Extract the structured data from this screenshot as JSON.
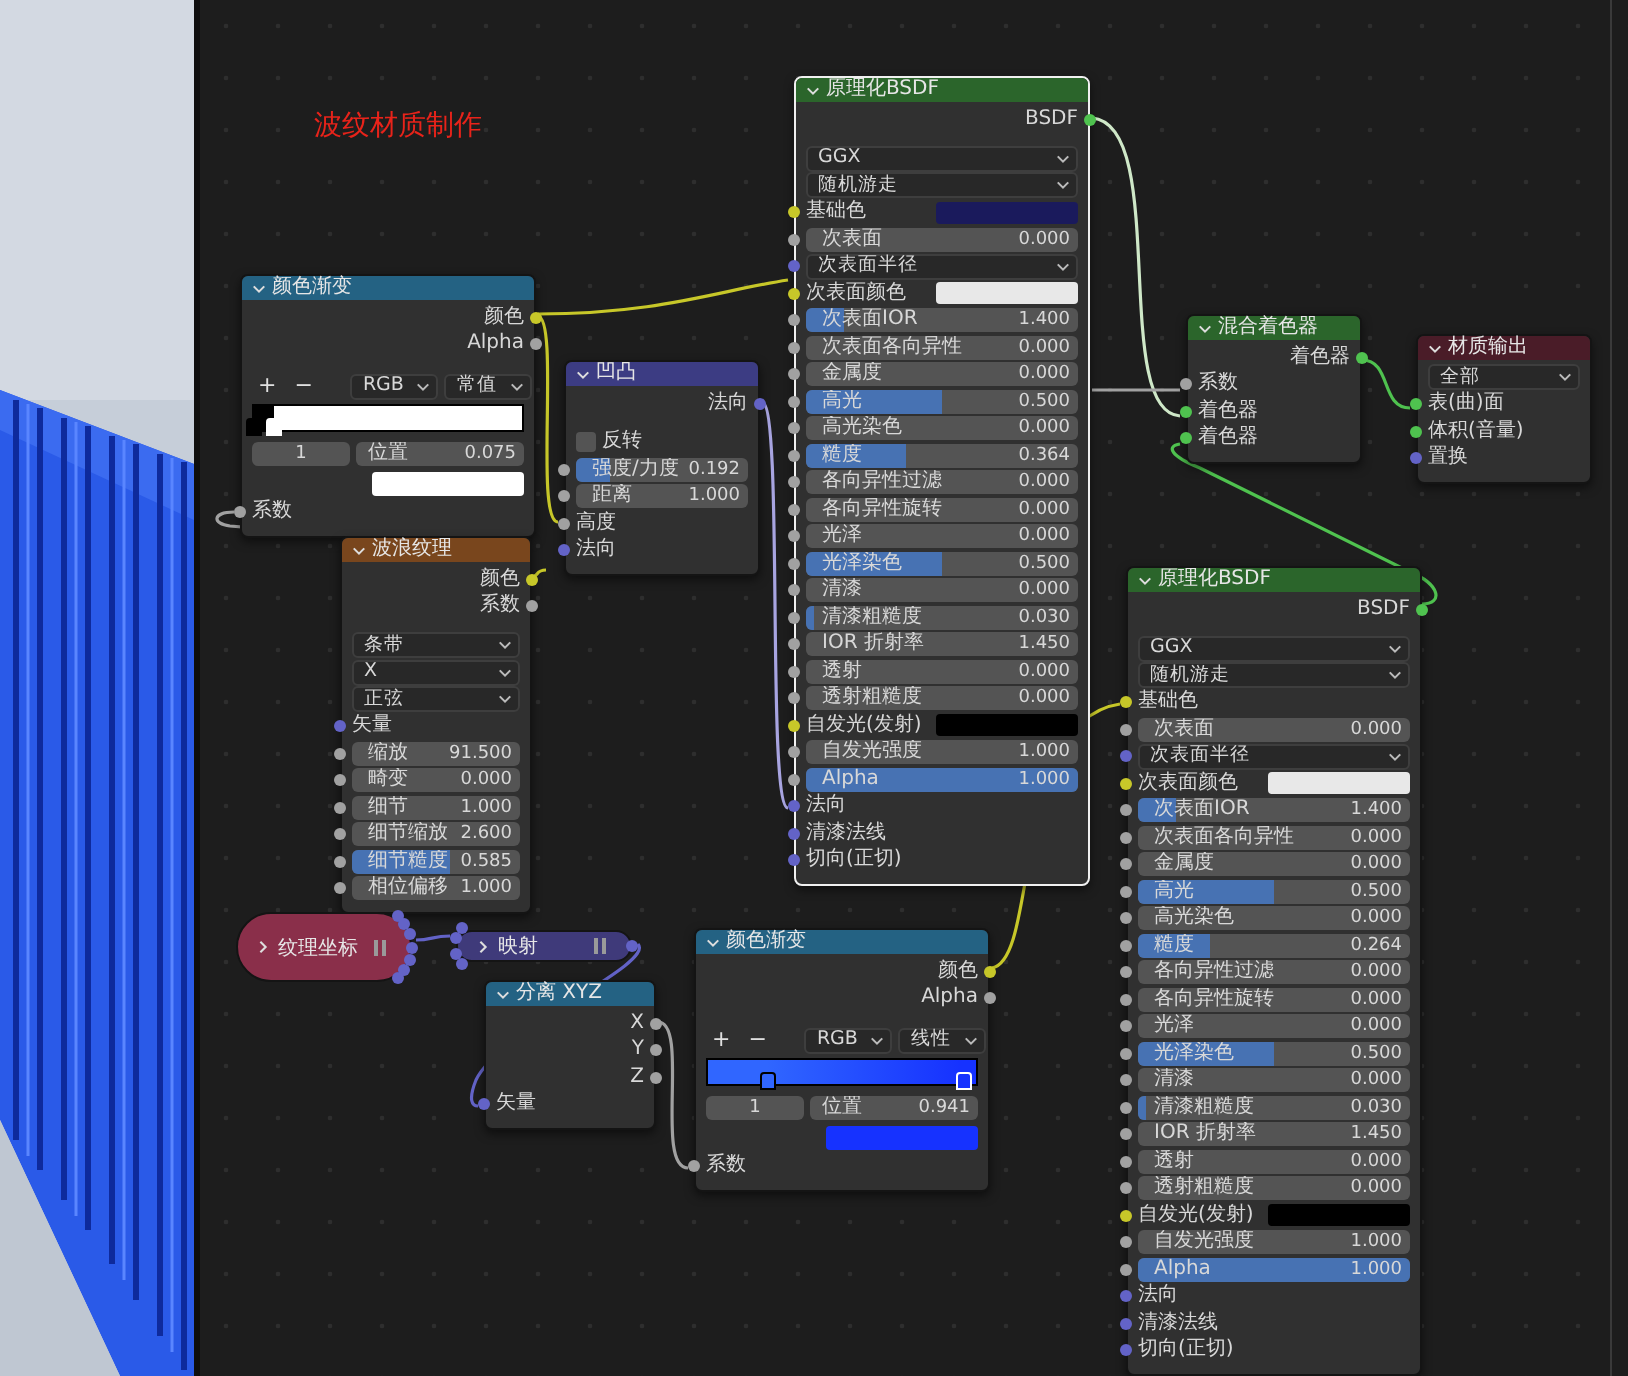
{
  "canvas_title": "波纹材质制作",
  "nodes": [
    {
      "kind": "node",
      "title": "原理化BSDF",
      "color": "#2b652b",
      "selected": true,
      "rows": [
        {
          "kind": "output",
          "label": "BSDF",
          "socket": {
            "color": "#4fc24f"
          }
        },
        {
          "kind": "dropdown",
          "label": "GGX"
        },
        {
          "kind": "dropdown",
          "label": "随机游走"
        },
        {
          "kind": "color",
          "label": "基础色",
          "color": "#1a1a5c",
          "socket": {
            "color": "#c7c729"
          }
        },
        {
          "kind": "number",
          "label": "次表面",
          "value": "0.000",
          "socket": {
            "color": "#a1a1a1"
          }
        },
        {
          "kind": "dropdown",
          "label": "次表面半径",
          "socket": {
            "color": "#6363c7"
          }
        },
        {
          "kind": "color",
          "label": "次表面颜色",
          "color": "#e8e8e8",
          "socket": {
            "color": "#c7c729"
          }
        },
        {
          "kind": "slider",
          "label": "次表面IOR",
          "value": "1.400",
          "level": 0.14,
          "socket": {
            "color": "#a1a1a1"
          }
        },
        {
          "kind": "number",
          "label": "次表面各向异性",
          "value": "0.000",
          "socket": {
            "color": "#a1a1a1"
          }
        },
        {
          "kind": "number",
          "label": "金属度",
          "value": "0.000",
          "socket": {
            "color": "#a1a1a1"
          }
        },
        {
          "kind": "slider",
          "label": "高光",
          "value": "0.500",
          "level": 0.5,
          "socket": {
            "color": "#a1a1a1"
          }
        },
        {
          "kind": "number",
          "label": "高光染色",
          "value": "0.000",
          "socket": {
            "color": "#a1a1a1"
          }
        },
        {
          "kind": "slider",
          "label": "糙度",
          "value": "0.364",
          "level": 0.364,
          "socket": {
            "color": "#a1a1a1"
          }
        },
        {
          "kind": "number",
          "label": "各向异性过滤",
          "value": "0.000",
          "socket": {
            "color": "#a1a1a1"
          }
        },
        {
          "kind": "number",
          "label": "各向异性旋转",
          "value": "0.000",
          "socket": {
            "color": "#a1a1a1"
          }
        },
        {
          "kind": "number",
          "label": "光泽",
          "value": "0.000",
          "socket": {
            "color": "#a1a1a1"
          }
        },
        {
          "kind": "slider",
          "label": "光泽染色",
          "value": "0.500",
          "level": 0.5,
          "socket": {
            "color": "#a1a1a1"
          }
        },
        {
          "kind": "number",
          "label": "清漆",
          "value": "0.000",
          "socket": {
            "color": "#a1a1a1"
          }
        },
        {
          "kind": "slider",
          "label": "清漆粗糙度",
          "value": "0.030",
          "level": 0.03,
          "socket": {
            "color": "#a1a1a1"
          }
        },
        {
          "kind": "number",
          "label": "IOR 折射率",
          "value": "1.450",
          "socket": {
            "color": "#a1a1a1"
          }
        },
        {
          "kind": "number",
          "label": "透射",
          "value": "0.000",
          "socket": {
            "color": "#a1a1a1"
          }
        },
        {
          "kind": "number",
          "label": "透射粗糙度",
          "value": "0.000",
          "socket": {
            "color": "#a1a1a1"
          }
        },
        {
          "kind": "color",
          "label": "自发光(发射)",
          "color": "#000000",
          "socket": {
            "color": "#c7c729"
          }
        },
        {
          "kind": "number",
          "label": "自发光强度",
          "value": "1.000",
          "socket": {
            "color": "#a1a1a1"
          }
        },
        {
          "kind": "slider",
          "label": "Alpha",
          "value": "1.000",
          "level": 1,
          "socket": {
            "color": "#a1a1a1"
          }
        },
        {
          "kind": "input",
          "label": "法向",
          "socket": {
            "color": "#6363c7"
          }
        },
        {
          "kind": "input",
          "label": "清漆法线",
          "socket": {
            "color": "#6363c7"
          }
        },
        {
          "kind": "input",
          "label": "切向(正切)",
          "socket": {
            "color": "#6363c7"
          }
        }
      ]
    },
    {
      "kind": "node",
      "title": "颜色渐变",
      "color": "#246283",
      "selected": false,
      "rows": [
        {
          "kind": "output",
          "label": "颜色",
          "socket": {
            "color": "#c7c729"
          }
        },
        {
          "kind": "output",
          "label": "Alpha",
          "socket": {
            "color": "#a1a1a1"
          }
        },
        {
          "kind": "ramp_controls",
          "add": "+",
          "remove": "−",
          "color_mode": "RGB",
          "interpolation": "常值"
        },
        {
          "kind": "ramp",
          "constant": true,
          "stops": [
            {
              "level": 0,
              "color": "#000000",
              "selected": false
            },
            {
              "level": 0.075,
              "color": "#ffffff",
              "selected": true
            }
          ]
        },
        {
          "kind": "ramp_position",
          "index": "1",
          "label": "位置",
          "value": "0.075"
        },
        {
          "kind": "swatch",
          "color": "#ffffff"
        },
        {
          "kind": "input",
          "label": "系数",
          "socket": {
            "color": "#a1a1a1"
          }
        }
      ]
    },
    {
      "kind": "node",
      "title": "凹凸",
      "color": "#3c3c83",
      "selected": false,
      "rows": [
        {
          "kind": "output",
          "label": "法向",
          "socket": {
            "color": "#6363c7"
          }
        },
        {
          "kind": "checkbox",
          "label": "反转",
          "checked": false
        },
        {
          "kind": "slider",
          "label": "强度/力度",
          "value": "0.192",
          "level": 0.192,
          "socket": {
            "color": "#a1a1a1"
          }
        },
        {
          "kind": "number",
          "label": "距离",
          "value": "1.000",
          "socket": {
            "color": "#a1a1a1"
          }
        },
        {
          "kind": "input",
          "label": "高度",
          "socket": {
            "color": "#a1a1a1"
          }
        },
        {
          "kind": "input",
          "label": "法向",
          "socket": {
            "color": "#6363c7"
          }
        }
      ]
    },
    {
      "kind": "node",
      "title": "混合着色器",
      "color": "#2b652b",
      "selected": false,
      "rows": [
        {
          "kind": "output",
          "label": "着色器",
          "socket": {
            "color": "#4fc24f"
          }
        },
        {
          "kind": "input",
          "label": "系数",
          "socket": {
            "color": "#a1a1a1"
          }
        },
        {
          "kind": "input",
          "label": "着色器",
          "socket": {
            "color": "#4fc24f"
          }
        },
        {
          "kind": "input",
          "label": "着色器",
          "socket": {
            "color": "#4fc24f"
          }
        }
      ]
    },
    {
      "kind": "node",
      "title": "材质输出",
      "color": "#4a1c28",
      "selected": false,
      "rows": [
        {
          "kind": "dropdown",
          "label": "全部"
        },
        {
          "kind": "input",
          "label": "表(曲)面",
          "socket": {
            "color": "#4fc24f"
          }
        },
        {
          "kind": "input",
          "label": "体积(音量)",
          "socket": {
            "color": "#4fc24f"
          }
        },
        {
          "kind": "input",
          "label": "置换",
          "socket": {
            "color": "#6363c7"
          }
        }
      ]
    },
    {
      "kind": "node",
      "title": "波浪纹理",
      "color": "#79461d",
      "selected": false,
      "rows": [
        {
          "kind": "output",
          "label": "颜色",
          "socket": {
            "color": "#c7c729"
          }
        },
        {
          "kind": "output",
          "label": "系数",
          "socket": {
            "color": "#a1a1a1"
          }
        },
        {
          "kind": "dropdown",
          "label": "条带"
        },
        {
          "kind": "dropdown",
          "label": "X"
        },
        {
          "kind": "dropdown",
          "label": "正弦"
        },
        {
          "kind": "input",
          "label": "矢量",
          "socket": {
            "color": "#6363c7"
          }
        },
        {
          "kind": "number",
          "label": "缩放",
          "value": "91.500",
          "socket": {
            "color": "#a1a1a1"
          }
        },
        {
          "kind": "number",
          "label": "畸变",
          "value": "0.000",
          "socket": {
            "color": "#a1a1a1"
          }
        },
        {
          "kind": "number",
          "label": "细节",
          "value": "1.000",
          "socket": {
            "color": "#a1a1a1"
          }
        },
        {
          "kind": "number",
          "label": "细节缩放",
          "value": "2.600",
          "socket": {
            "color": "#a1a1a1"
          }
        },
        {
          "kind": "slider",
          "label": "细节糙度",
          "value": "0.585",
          "level": 0.585,
          "socket": {
            "color": "#a1a1a1"
          }
        },
        {
          "kind": "number",
          "label": "相位偏移",
          "value": "1.000",
          "socket": {
            "color": "#a1a1a1"
          }
        }
      ]
    },
    {
      "kind": "node",
      "title": "原理化BSDF",
      "color": "#2b652b",
      "selected": false,
      "rows": [
        {
          "kind": "output",
          "label": "BSDF",
          "socket": {
            "color": "#4fc24f"
          }
        },
        {
          "kind": "dropdown",
          "label": "GGX"
        },
        {
          "kind": "dropdown",
          "label": "随机游走"
        },
        {
          "kind": "input",
          "label": "基础色",
          "socket": {
            "color": "#c7c729"
          }
        },
        {
          "kind": "number",
          "label": "次表面",
          "value": "0.000",
          "socket": {
            "color": "#a1a1a1"
          }
        },
        {
          "kind": "dropdown",
          "label": "次表面半径",
          "socket": {
            "color": "#6363c7"
          }
        },
        {
          "kind": "color",
          "label": "次表面颜色",
          "color": "#e8e8e8",
          "socket": {
            "color": "#c7c729"
          }
        },
        {
          "kind": "slider",
          "label": "次表面IOR",
          "value": "1.400",
          "level": 0.14,
          "socket": {
            "color": "#a1a1a1"
          }
        },
        {
          "kind": "number",
          "label": "次表面各向异性",
          "value": "0.000",
          "socket": {
            "color": "#a1a1a1"
          }
        },
        {
          "kind": "number",
          "label": "金属度",
          "value": "0.000",
          "socket": {
            "color": "#a1a1a1"
          }
        },
        {
          "kind": "slider",
          "label": "高光",
          "value": "0.500",
          "level": 0.5,
          "socket": {
            "color": "#a1a1a1"
          }
        },
        {
          "kind": "number",
          "label": "高光染色",
          "value": "0.000",
          "socket": {
            "color": "#a1a1a1"
          }
        },
        {
          "kind": "slider",
          "label": "糙度",
          "value": "0.264",
          "level": 0.264,
          "socket": {
            "color": "#a1a1a1"
          }
        },
        {
          "kind": "number",
          "label": "各向异性过滤",
          "value": "0.000",
          "socket": {
            "color": "#a1a1a1"
          }
        },
        {
          "kind": "number",
          "label": "各向异性旋转",
          "value": "0.000",
          "socket": {
            "color": "#a1a1a1"
          }
        },
        {
          "kind": "number",
          "label": "光泽",
          "value": "0.000",
          "socket": {
            "color": "#a1a1a1"
          }
        },
        {
          "kind": "slider",
          "label": "光泽染色",
          "value": "0.500",
          "level": 0.5,
          "socket": {
            "color": "#a1a1a1"
          }
        },
        {
          "kind": "number",
          "label": "清漆",
          "value": "0.000",
          "socket": {
            "color": "#a1a1a1"
          }
        },
        {
          "kind": "slider",
          "label": "清漆粗糙度",
          "value": "0.030",
          "level": 0.03,
          "socket": {
            "color": "#a1a1a1"
          }
        },
        {
          "kind": "number",
          "label": "IOR 折射率",
          "value": "1.450",
          "socket": {
            "color": "#a1a1a1"
          }
        },
        {
          "kind": "number",
          "label": "透射",
          "value": "0.000",
          "socket": {
            "color": "#a1a1a1"
          }
        },
        {
          "kind": "number",
          "label": "透射粗糙度",
          "value": "0.000",
          "socket": {
            "color": "#a1a1a1"
          }
        },
        {
          "kind": "color",
          "label": "自发光(发射)",
          "color": "#000000",
          "socket": {
            "color": "#c7c729"
          }
        },
        {
          "kind": "number",
          "label": "自发光强度",
          "value": "1.000",
          "socket": {
            "color": "#a1a1a1"
          }
        },
        {
          "kind": "slider",
          "label": "Alpha",
          "value": "1.000",
          "level": 1,
          "socket": {
            "color": "#a1a1a1"
          }
        },
        {
          "kind": "input",
          "label": "法向",
          "socket": {
            "color": "#6363c7"
          }
        },
        {
          "kind": "input",
          "label": "清漆法线",
          "socket": {
            "color": "#6363c7"
          }
        },
        {
          "kind": "input",
          "label": "切向(正切)",
          "socket": {
            "color": "#6363c7"
          }
        }
      ]
    },
    {
      "kind": "collapsed",
      "title": "纹理坐标",
      "color": "#8a2f4a",
      "selected": false,
      "sockets_out": [
        {
          "color": "#6363c7"
        },
        {
          "color": "#6363c7"
        },
        {
          "color": "#6363c7"
        },
        {
          "color": "#6363c7"
        },
        {
          "color": "#6363c7"
        },
        {
          "color": "#6363c7"
        },
        {
          "color": "#6363c7"
        }
      ]
    },
    {
      "kind": "collapsed",
      "title": "映射",
      "color": "#3f3a7a",
      "selected": false,
      "sockets_in": [
        {
          "color": "#6363c7"
        },
        {
          "color": "#6363c7"
        },
        {
          "color": "#6363c7"
        },
        {
          "color": "#6363c7"
        }
      ],
      "sockets_out": [
        {
          "color": "#6363c7"
        }
      ]
    },
    {
      "kind": "node",
      "title": "分离 XYZ",
      "color": "#246283",
      "selected": false,
      "rows": [
        {
          "kind": "output",
          "label": "X",
          "socket": {
            "color": "#a1a1a1"
          }
        },
        {
          "kind": "output",
          "label": "Y",
          "socket": {
            "color": "#a1a1a1"
          }
        },
        {
          "kind": "output",
          "label": "Z",
          "socket": {
            "color": "#a1a1a1"
          }
        },
        {
          "kind": "input",
          "label": "矢量",
          "socket": {
            "color": "#6363c7"
          }
        }
      ]
    },
    {
      "kind": "node",
      "title": "颜色渐变",
      "color": "#246283",
      "selected": false,
      "rows": [
        {
          "kind": "output",
          "label": "颜色",
          "socket": {
            "color": "#c7c729"
          }
        },
        {
          "kind": "output",
          "label": "Alpha",
          "socket": {
            "color": "#a1a1a1"
          }
        },
        {
          "kind": "ramp_controls",
          "add": "+",
          "remove": "−",
          "color_mode": "RGB",
          "interpolation": "线性"
        },
        {
          "kind": "ramp",
          "constant": false,
          "stops": [
            {
              "level": 0.22,
              "color": "#3066ff",
              "selected": false
            },
            {
              "level": 0.941,
              "color": "#1632ff",
              "selected": true
            }
          ]
        },
        {
          "kind": "ramp_position",
          "index": "1",
          "label": "位置",
          "value": "0.941"
        },
        {
          "kind": "swatch",
          "color": "#1632ff"
        },
        {
          "kind": "input",
          "label": "系数",
          "socket": {
            "color": "#a1a1a1"
          }
        }
      ]
    }
  ]
}
